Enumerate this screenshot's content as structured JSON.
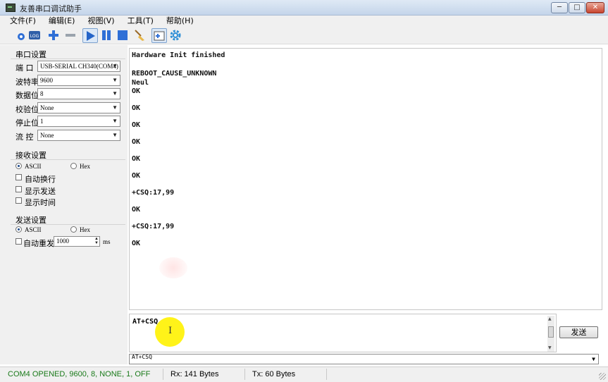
{
  "window": {
    "title": "友善串口调试助手",
    "controls": {
      "minimize": "─",
      "maximize": "□",
      "close": "✕"
    }
  },
  "menu": [
    "文件(F)",
    "编辑(E)",
    "视图(V)",
    "工具(T)",
    "帮助(H)"
  ],
  "toolbar": {
    "log_label": "LOG",
    "icons": [
      "open-icon",
      "log-icon",
      "add-icon",
      "remove-icon",
      "play-icon",
      "pause-icon",
      "stop-icon",
      "broom-icon",
      "split-view-icon",
      "gear-icon"
    ]
  },
  "serial": {
    "title": "串口设置",
    "port_label": "端  口",
    "port_value": "USB-SERIAL CH340(COM4)",
    "baud_label": "波特率",
    "baud_value": "9600",
    "databits_label": "数据位",
    "databits_value": "8",
    "parity_label": "校验位",
    "parity_value": "None",
    "stopbits_label": "停止位",
    "stopbits_value": "1",
    "flow_label": "流  控",
    "flow_value": "None"
  },
  "receive": {
    "title": "接收设置",
    "ascii": "ASCII",
    "hex": "Hex",
    "mode": "ascii",
    "auto_newline": "自动换行",
    "show_send": "显示发送",
    "show_time": "显示时间"
  },
  "send": {
    "title": "发送设置",
    "ascii": "ASCII",
    "hex": "Hex",
    "mode": "ascii",
    "auto_resend": "自动重发",
    "interval": "1000",
    "unit": "ms",
    "input": "AT+CSQ",
    "button": "发送",
    "history_value": "AT+CSQ"
  },
  "output": [
    "Hardware Init finished",
    "",
    "REBOOT_CAUSE_UNKNOWN",
    "Neul",
    "OK",
    "",
    "OK",
    "",
    "OK",
    "",
    "OK",
    "",
    "OK",
    "",
    "OK",
    "",
    "+CSQ:17,99",
    "",
    "OK",
    "",
    "+CSQ:17,99",
    "",
    "OK"
  ],
  "status": {
    "connection": "COM4 OPENED, 9600, 8, NONE, 1, OFF",
    "connection_color": "#1a7a1a",
    "rx": "Rx: 141 Bytes",
    "tx": "Tx: 60 Bytes"
  }
}
